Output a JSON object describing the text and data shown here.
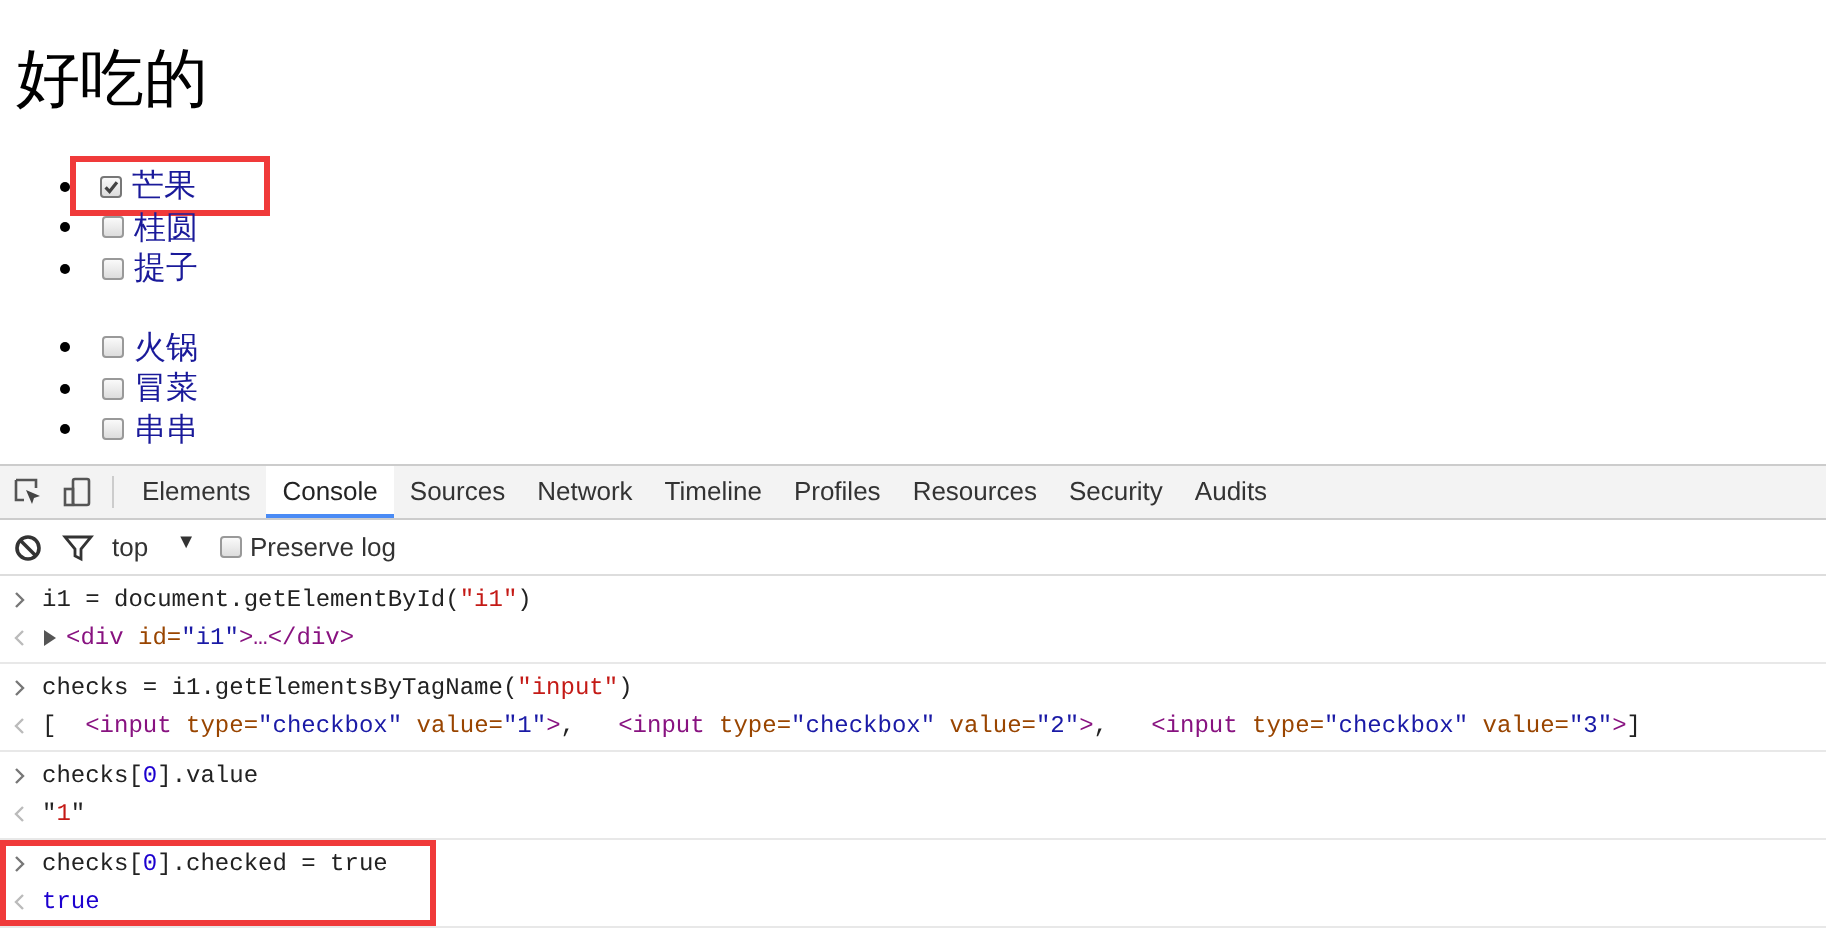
{
  "heading": "好吃的",
  "lists": [
    {
      "items": [
        {
          "label": "芒果",
          "checked": true,
          "highlighted": true
        },
        {
          "label": "桂圆",
          "checked": false,
          "highlighted": false
        },
        {
          "label": "提子",
          "checked": false,
          "highlighted": false
        }
      ]
    },
    {
      "items": [
        {
          "label": "火锅",
          "checked": false,
          "highlighted": false
        },
        {
          "label": "冒菜",
          "checked": false,
          "highlighted": false
        },
        {
          "label": "串串",
          "checked": false,
          "highlighted": false
        }
      ]
    }
  ],
  "devtools": {
    "tabs": [
      {
        "label": "Elements",
        "selected": false
      },
      {
        "label": "Console",
        "selected": true
      },
      {
        "label": "Sources",
        "selected": false
      },
      {
        "label": "Network",
        "selected": false
      },
      {
        "label": "Timeline",
        "selected": false
      },
      {
        "label": "Profiles",
        "selected": false
      },
      {
        "label": "Resources",
        "selected": false
      },
      {
        "label": "Security",
        "selected": false
      },
      {
        "label": "Audits",
        "selected": false
      }
    ],
    "context": "top",
    "context_arrow": "▼",
    "preserve_log": {
      "label": "Preserve log",
      "checked": false
    },
    "entries": [
      {
        "highlighted": false,
        "input": [
          {
            "t": "i1 = document.getElementById(",
            "kind": "plain"
          },
          {
            "t": "\"i1\"",
            "kind": "string"
          },
          {
            "t": ")",
            "kind": "plain"
          }
        ],
        "output": {
          "expandable": true,
          "tokens": [
            {
              "t": "<div",
              "kind": "tag"
            },
            {
              "t": " id",
              "kind": "attr"
            },
            {
              "t": "=",
              "kind": "attr"
            },
            {
              "t": "\"i1\"",
              "kind": "value"
            },
            {
              "t": ">…</div>",
              "kind": "tag"
            }
          ]
        }
      },
      {
        "highlighted": false,
        "input": [
          {
            "t": "checks = i1.getElementsByTagName(",
            "kind": "plain"
          },
          {
            "t": "\"input\"",
            "kind": "string"
          },
          {
            "t": ")",
            "kind": "plain"
          }
        ],
        "output": {
          "expandable": false,
          "tokens": [
            {
              "t": "[  ",
              "kind": "plain"
            },
            {
              "t": "<input",
              "kind": "tag"
            },
            {
              "t": " type",
              "kind": "attr"
            },
            {
              "t": "=",
              "kind": "attr"
            },
            {
              "t": "\"checkbox\"",
              "kind": "value"
            },
            {
              "t": " value",
              "kind": "attr"
            },
            {
              "t": "=",
              "kind": "attr"
            },
            {
              "t": "\"1\"",
              "kind": "value"
            },
            {
              "t": ">",
              "kind": "tag"
            },
            {
              "t": ",   ",
              "kind": "plain"
            },
            {
              "t": "<input",
              "kind": "tag"
            },
            {
              "t": " type",
              "kind": "attr"
            },
            {
              "t": "=",
              "kind": "attr"
            },
            {
              "t": "\"checkbox\"",
              "kind": "value"
            },
            {
              "t": " value",
              "kind": "attr"
            },
            {
              "t": "=",
              "kind": "attr"
            },
            {
              "t": "\"2\"",
              "kind": "value"
            },
            {
              "t": ">",
              "kind": "tag"
            },
            {
              "t": ",   ",
              "kind": "plain"
            },
            {
              "t": "<input",
              "kind": "tag"
            },
            {
              "t": " type",
              "kind": "attr"
            },
            {
              "t": "=",
              "kind": "attr"
            },
            {
              "t": "\"checkbox\"",
              "kind": "value"
            },
            {
              "t": " value",
              "kind": "attr"
            },
            {
              "t": "=",
              "kind": "attr"
            },
            {
              "t": "\"3\"",
              "kind": "value"
            },
            {
              "t": ">",
              "kind": "tag"
            },
            {
              "t": "]",
              "kind": "plain"
            }
          ]
        }
      },
      {
        "highlighted": false,
        "input": [
          {
            "t": "checks[",
            "kind": "plain"
          },
          {
            "t": "0",
            "kind": "number"
          },
          {
            "t": "].value",
            "kind": "plain"
          }
        ],
        "output": {
          "expandable": false,
          "tokens": [
            {
              "t": "\"",
              "kind": "plain"
            },
            {
              "t": "1",
              "kind": "string"
            },
            {
              "t": "\"",
              "kind": "plain"
            }
          ]
        }
      },
      {
        "highlighted": true,
        "input": [
          {
            "t": "checks[",
            "kind": "plain"
          },
          {
            "t": "0",
            "kind": "number"
          },
          {
            "t": "].checked = true",
            "kind": "plain"
          }
        ],
        "output": {
          "expandable": false,
          "tokens": [
            {
              "t": "true",
              "kind": "keyword"
            }
          ]
        }
      }
    ]
  }
}
